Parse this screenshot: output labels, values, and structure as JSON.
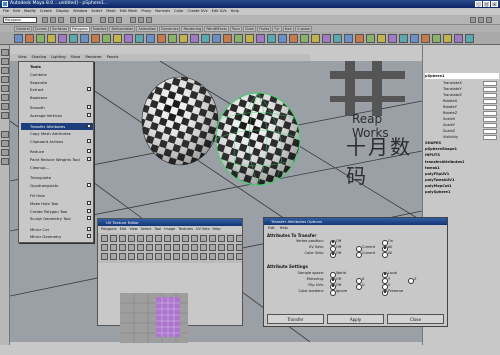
{
  "window": {
    "title": "Autodesk Maya 8.0 ...untitled] - pSphere1..."
  },
  "menubar": [
    "File",
    "Edit",
    "Modify",
    "Create",
    "Display",
    "Window",
    "Select",
    "Mesh",
    "Edit Mesh",
    "Proxy",
    "Normals",
    "Color",
    "Create UVs",
    "Edit UVs",
    "Help"
  ],
  "status": {
    "mode": "Polygons"
  },
  "shelf_tabs": [
    "General",
    "Curves",
    "Surfaces",
    "Polygons",
    "Subdivs",
    "Deformation",
    "Animation",
    "Dynamics",
    "Rendering",
    "PaintEffects",
    "Toon",
    "Cloth",
    "Fluids",
    "Fur",
    "Hair",
    "Custom"
  ],
  "viewport_menu": [
    "View",
    "Shading",
    "Lighting",
    "Show",
    "Renderer",
    "Panels"
  ],
  "context_menu": {
    "header": "Tools",
    "items": [
      {
        "label": "Combine",
        "options": false
      },
      {
        "label": "Separate",
        "options": false
      },
      {
        "label": "Extract",
        "options": true
      },
      {
        "label": "Booleans",
        "options": false
      },
      {
        "label": "Smooth",
        "options": true
      },
      {
        "label": "Average Vertices",
        "options": true
      },
      {
        "label": "Transfer Attributes",
        "options": true,
        "selected": true
      },
      {
        "label": "Copy Mesh Attributes",
        "options": false
      },
      {
        "label": "Clipboard Actions",
        "options": true
      },
      {
        "label": "Reduce",
        "options": true
      },
      {
        "label": "Paint Reduce Weights Tool",
        "options": true
      },
      {
        "label": "Cleanup...",
        "options": false
      },
      {
        "label": "Triangulate",
        "options": false
      },
      {
        "label": "Quadrangulate",
        "options": true
      },
      {
        "label": "Fill Hole",
        "options": false
      },
      {
        "label": "Make Hole Tool",
        "options": true
      },
      {
        "label": "Create Polygon Tool",
        "options": true
      },
      {
        "label": "Sculpt Geometry Tool",
        "options": true
      },
      {
        "label": "Mirror Cut",
        "options": true
      },
      {
        "label": "Mirror Geometry",
        "options": true
      }
    ]
  },
  "channel_box": {
    "object": "pSphere1",
    "channels": [
      "TranslateX",
      "TranslateY",
      "TranslateZ",
      "RotateX",
      "RotateY",
      "RotateZ",
      "ScaleX",
      "ScaleY",
      "ScaleZ",
      "Visibility"
    ],
    "shape_header": "SHAPES",
    "shape": "pSphereShape1",
    "inputs_header": "INPUTS",
    "inputs": [
      "transferAttributes1",
      "tweak1",
      "polyFlipUV1",
      "polyTweakUV1",
      "polyMapCut1",
      "polySphere1"
    ]
  },
  "watermark": {
    "latin": "Reap Works",
    "chinese": "十月数码"
  },
  "uv_editor": {
    "title": "UV Texture Editor",
    "menu": [
      "Polygons",
      "Edit",
      "View",
      "Select",
      "Tool",
      "Image",
      "Textures",
      "UV Sets",
      "Help"
    ]
  },
  "transfer_options": {
    "title": "Transfer Attributes Options",
    "menu": [
      "Edit",
      "Help"
    ],
    "section1": "Attributes To Transfer",
    "vertex_position": {
      "label": "Vertex position:",
      "options": [
        "Off",
        "On"
      ],
      "selected": "Off"
    },
    "uv_sets": {
      "label": "UV Sets:",
      "options": [
        "Off",
        "Current",
        "All"
      ],
      "selected": "All"
    },
    "color_sets": {
      "label": "Color Sets:",
      "options": [
        "Off",
        "Current",
        "All"
      ],
      "selected": "Off"
    },
    "section2": "Attribute Settings",
    "sample_space": {
      "label": "Sample space:",
      "options": [
        "World",
        "Local"
      ],
      "selected": "Local"
    },
    "mirroring": {
      "label": "Mirroring:",
      "options": [
        "Off",
        "X",
        "Y",
        "Z"
      ],
      "selected": "Off"
    },
    "flip_uvs": {
      "label": "Flip UVs:",
      "options": [
        "Off",
        "U",
        "V"
      ],
      "selected": "Off"
    },
    "color_borders": {
      "label": "Color borders:",
      "options": [
        "Ignore",
        "Preserve"
      ],
      "selected": "Preserve"
    },
    "buttons": [
      "Transfer",
      "Apply",
      "Close"
    ]
  }
}
